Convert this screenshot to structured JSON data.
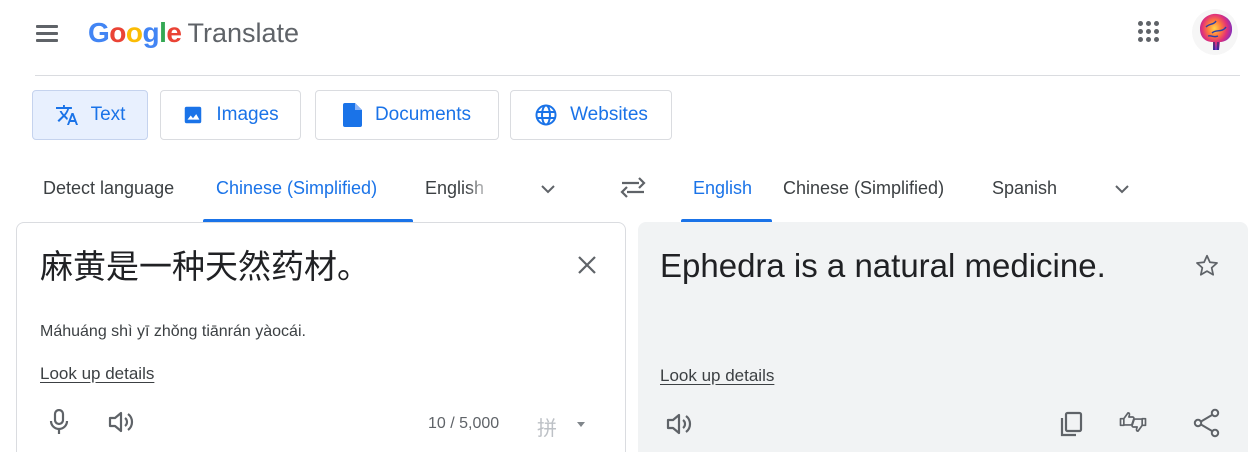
{
  "app": {
    "logo_letters": [
      {
        "char": "G",
        "color": "#4285F4"
      },
      {
        "char": "o",
        "color": "#EA4335"
      },
      {
        "char": "o",
        "color": "#FBBC05"
      },
      {
        "char": "g",
        "color": "#4285F4"
      },
      {
        "char": "l",
        "color": "#34A853"
      },
      {
        "char": "e",
        "color": "#EA4335"
      }
    ],
    "product_name": "Translate",
    "icons": {
      "menu": "hamburger-menu-icon",
      "apps": "apps-grid-icon",
      "avatar": "user-avatar"
    }
  },
  "mode_tabs": [
    {
      "label": "Text",
      "icon": "translate-icon",
      "active": true
    },
    {
      "label": "Images",
      "icon": "image-icon",
      "active": false
    },
    {
      "label": "Documents",
      "icon": "document-icon",
      "active": false
    },
    {
      "label": "Websites",
      "icon": "globe-icon",
      "active": false
    }
  ],
  "source_languages": {
    "options": [
      "Detect language",
      "Chinese (Simplified)",
      "English"
    ],
    "selected": "Chinese (Simplified)"
  },
  "target_languages": {
    "options": [
      "English",
      "Chinese (Simplified)",
      "Spanish"
    ],
    "selected": "English"
  },
  "source": {
    "text": "麻黄是一种天然药材。",
    "romanization": "Máhuáng shì yī zhǒng tiānrán yàocái.",
    "lookup_link": "Look up details",
    "char_count": "10 / 5,000",
    "input_tool": "拼"
  },
  "target": {
    "text": "Ephedra is a natural medicine.",
    "lookup_link": "Look up details"
  },
  "colors": {
    "accent": "#1a73e8",
    "active_tab_bg": "#e8f0fe",
    "target_bg": "#f1f3f4"
  }
}
